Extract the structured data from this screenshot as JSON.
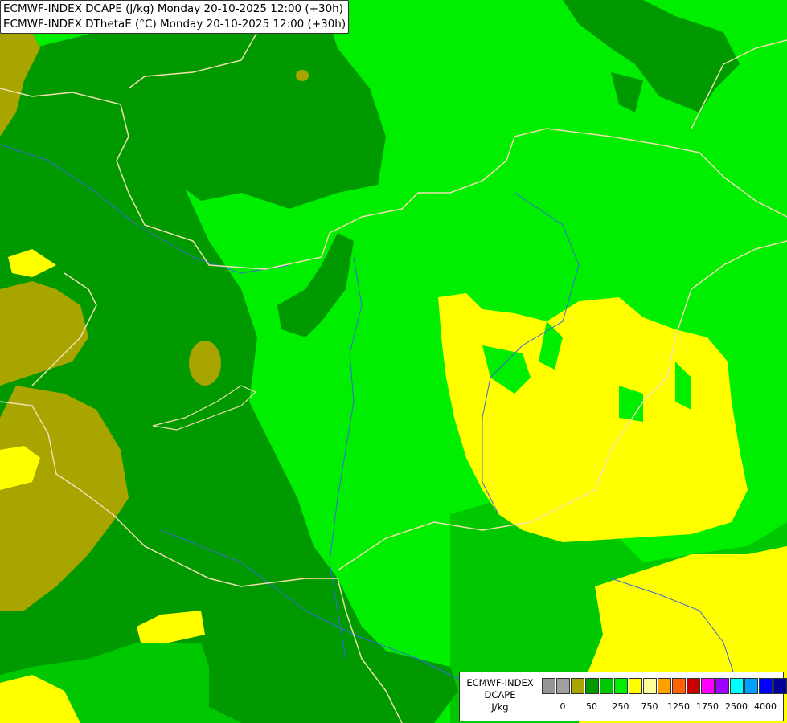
{
  "title": {
    "line1": "ECMWF-INDEX DCAPE (J/kg) Monday 20-10-2025 12:00 (+30h)",
    "line2": "ECMWF-INDEX DThetaE (°C) Monday 20-10-2025 12:00 (+30h)"
  },
  "legend": {
    "model": "ECMWF-INDEX",
    "variable": "DCAPE",
    "unit": "J/kg",
    "colors": [
      "#969696",
      "#a0a0a0",
      "#a8a400",
      "#009a00",
      "#00c800",
      "#00ee00",
      "#ffff00",
      "#ffff99",
      "#ffa000",
      "#ff6400",
      "#c80000",
      "#ff00ff",
      "#a000ff",
      "#00ffff",
      "#00a0ff",
      "#0000ff",
      "#000096"
    ],
    "tick_labels": [
      "0",
      "50",
      "250",
      "750",
      "1250",
      "1750",
      "2500",
      "4000"
    ]
  },
  "map_colors": {
    "light_green": "#00ee00",
    "medium_green": "#00c800",
    "dark_green": "#009a00",
    "olive": "#a8a400",
    "yellow": "#ffff00",
    "border": "#f0e0b0",
    "river": "#3a6ad8"
  }
}
